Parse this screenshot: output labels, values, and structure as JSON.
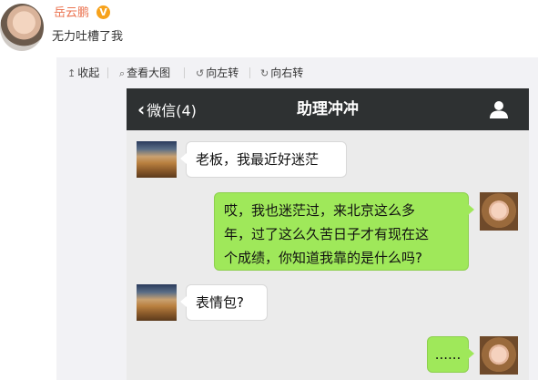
{
  "post": {
    "username": "岳云鹏",
    "verified_badge": "V",
    "text": "无力吐槽了我"
  },
  "toolbar": {
    "collapse": "收起",
    "view_large": "查看大图",
    "rotate_left": "向左转",
    "rotate_right": "向右转",
    "icons": [
      "arrow-up-icon",
      "magnifier-icon",
      "rotate-left-icon",
      "rotate-right-icon"
    ]
  },
  "wechat": {
    "back_label": "微信(4)",
    "title": "助理冲冲",
    "nav_color": "#2e3132",
    "outgoing_bubble_color": "#9fe85a",
    "messages": [
      {
        "side": "left",
        "text": "老板，我最近好迷茫"
      },
      {
        "side": "right",
        "lines": [
          "哎，我也迷茫过，来北京这么多",
          "年，过了这么久苦日子才有现在这",
          "个成绩，你知道我靠的是什么吗?"
        ]
      },
      {
        "side": "left",
        "text": "表情包?"
      },
      {
        "side": "right",
        "text": "......"
      }
    ]
  }
}
